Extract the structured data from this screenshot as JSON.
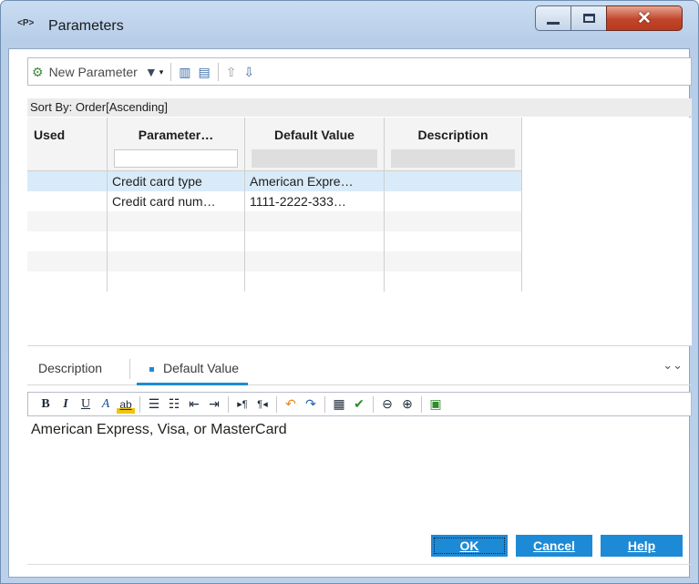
{
  "window": {
    "title": "Parameters",
    "icon_text": "<P>",
    "controls": {
      "minimize": "minimize-icon",
      "maximize": "maximize-icon",
      "close": "close-icon"
    }
  },
  "toolbar": {
    "new_parameter_label": "New Parameter",
    "icons": [
      "new-parameter-icon",
      "filter-icon",
      "dropdown-icon",
      "select-columns-icon",
      "edit-icon",
      "move-up-icon",
      "move-down-icon"
    ]
  },
  "sort": {
    "label": "Sort By: Order[Ascending]"
  },
  "grid": {
    "columns": [
      "Used",
      "Parameter…",
      "Default Value",
      "Description"
    ],
    "rows": [
      {
        "used": "",
        "name": "Credit card type",
        "default": "American Expre…",
        "description": ""
      },
      {
        "used": "",
        "name": "Credit card num…",
        "default": "1111-2222-333…",
        "description": ""
      }
    ]
  },
  "tabs": {
    "description": "Description",
    "default_value": "Default Value",
    "active": "Default Value"
  },
  "format_toolbar": {
    "icons": [
      "bold-icon",
      "italic-icon",
      "underline-icon",
      "font-color-icon",
      "highlight-icon",
      "bulleted-list-icon",
      "numbered-list-icon",
      "decrease-indent-icon",
      "increase-indent-icon",
      "ltr-icon",
      "rtl-icon",
      "undo-icon",
      "redo-icon",
      "table-icon",
      "spell-check-icon",
      "zoom-out-icon",
      "zoom-in-icon",
      "fullscreen-icon"
    ],
    "labels": {
      "bold": "B",
      "italic": "I",
      "underline": "U",
      "font_color": "A",
      "highlight": "ab"
    }
  },
  "editor": {
    "text": "American Express, Visa, or MasterCard"
  },
  "buttons": {
    "ok": "OK",
    "cancel": "Cancel",
    "help": "Help"
  },
  "colors": {
    "accent": "#1d8ad6",
    "selected_row": "#d9ebf9",
    "close_button": "#c1452b"
  }
}
